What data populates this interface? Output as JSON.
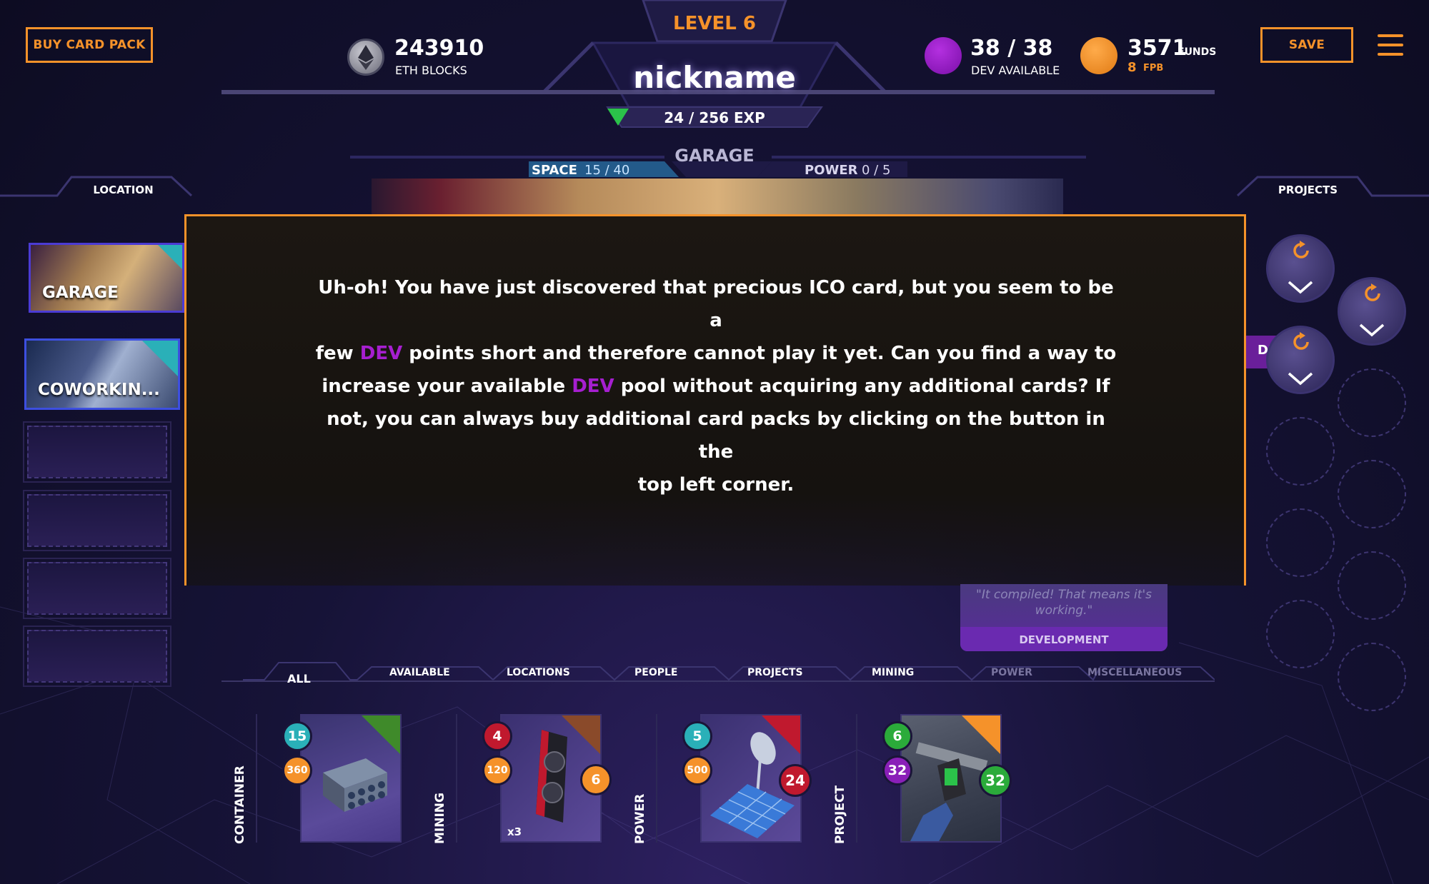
{
  "header": {
    "buy_label": "BUY CARD PACK",
    "save_label": "SAVE",
    "level": "LEVEL 6",
    "nickname": "nickname",
    "exp": "24 / 256 EXP",
    "eth_value": "243910",
    "eth_label": "ETH BLOCKS",
    "dev_value": "38 / 38",
    "dev_label": "DEV AVAILABLE",
    "funds_value": "3571",
    "funds_label": "FUNDS",
    "fpb_value": "8",
    "fpb_label": "FPB"
  },
  "location_panel": {
    "title": "GARAGE",
    "space_label": "SPACE",
    "space_value": "15 / 40",
    "power_label": "POWER",
    "power_value": "0 / 5"
  },
  "sidebar_left": {
    "heading": "LOCATION",
    "cards": [
      {
        "label": "GARAGE"
      },
      {
        "label": "COWORKIN..."
      }
    ]
  },
  "sidebar_right": {
    "heading": "PROJECTS",
    "dev_tag": "DEV"
  },
  "modal": {
    "line1": "Uh-oh! You have just discovered that precious ICO card, but you seem to be a",
    "line2a": "few ",
    "dev1": "DEV",
    "line2b": " points short and therefore cannot play it yet. Can you find a way to",
    "line3a": "increase your available ",
    "dev2": "DEV",
    "line3b": " pool without acquiring any additional cards? If",
    "line4": "not, you can always buy additional card packs by clicking on the button in the",
    "line5": "top left corner."
  },
  "peek_card": {
    "quote": "\"It compiled! That means it's working.\"",
    "type": "DEVELOPMENT"
  },
  "tabs": [
    "ALL",
    "AVAILABLE",
    "LOCATIONS",
    "PEOPLE",
    "PROJECTS",
    "MINING",
    "POWER",
    "MISCELLANEOUS"
  ],
  "hand": [
    {
      "category": "CONTAINER",
      "badge_top": "15",
      "badge_mid": "360",
      "corner_color": "#3f8a2a"
    },
    {
      "category": "MINING",
      "badge_top": "4",
      "badge_mid": "120",
      "badge_right": "6",
      "count": "x3",
      "corner_color": "#8a4a2a"
    },
    {
      "category": "POWER",
      "badge_top": "5",
      "badge_mid": "500",
      "badge_right": "24",
      "corner_color": "#c0192e"
    },
    {
      "category": "PROJECT",
      "badge_top": "6",
      "badge_mid": "32",
      "badge_right": "32",
      "corner_color": "#f5922a"
    }
  ],
  "colors": {
    "accent": "#f5922a",
    "dev": "#a61fd0",
    "background": "#161337",
    "teal": "#2ab0b8"
  }
}
